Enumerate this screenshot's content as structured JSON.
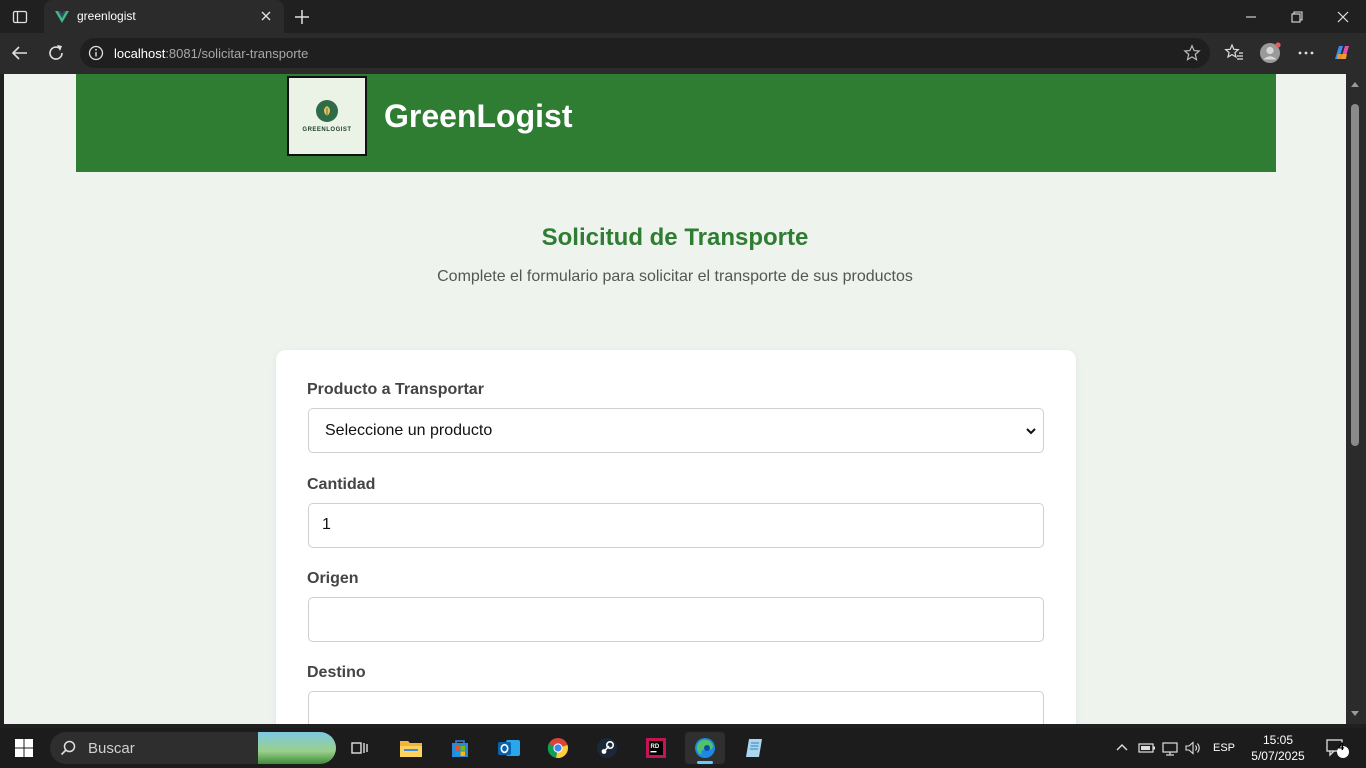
{
  "browser": {
    "tab_title": "greenlogist",
    "url_host": "localhost",
    "url_rest": ":8081/solicitar-transporte"
  },
  "site": {
    "logo_text": "GREENLOGIST",
    "brand": "GreenLogist",
    "brand_color": "#2e7d32"
  },
  "page": {
    "title": "Solicitud de Transporte",
    "subtitle": "Complete el formulario para solicitar el transporte de sus productos"
  },
  "form": {
    "product_label": "Producto a Transportar",
    "product_selected": "Seleccione un producto",
    "quantity_label": "Cantidad",
    "quantity_value": "1",
    "origin_label": "Origen",
    "origin_value": "",
    "destination_label": "Destino",
    "destination_value": ""
  },
  "taskbar": {
    "search_text": "Buscar",
    "language": "ESP",
    "time": "15:05",
    "date": "5/07/2025",
    "notification_count": "4"
  }
}
